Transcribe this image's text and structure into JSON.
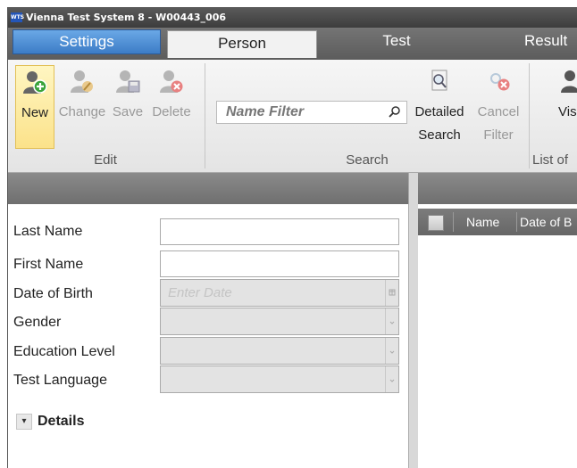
{
  "window": {
    "title": "Vienna Test System 8 - W00443_006",
    "logo_text": "WTS"
  },
  "tabs": [
    {
      "label": "Settings"
    },
    {
      "label": "Person"
    },
    {
      "label": "Test"
    },
    {
      "label": "Result"
    }
  ],
  "ribbon": {
    "edit": {
      "label": "Edit",
      "new": "New",
      "change": "Change",
      "save": "Save",
      "delete": "Delete"
    },
    "search": {
      "label": "Search",
      "name_filter_placeholder": "Name Filter",
      "detailed_search_line1": "Detailed",
      "detailed_search_line2": "Search",
      "cancel_filter_line1": "Cancel",
      "cancel_filter_line2": "Filter"
    },
    "list": {
      "label": "List of",
      "visible_label": "Vis"
    }
  },
  "form": {
    "last_name": "Last Name",
    "first_name": "First Name",
    "date_of_birth": "Date of Birth",
    "date_placeholder": "Enter Date",
    "gender": "Gender",
    "education_level": "Education Level",
    "test_language": "Test Language",
    "details": "Details"
  },
  "grid": {
    "columns": [
      "Name",
      "Date of B"
    ]
  },
  "colors": {
    "accent_blue": "#3c7cc6",
    "new_highlight": "#fbe28a",
    "add_green": "#3aa33a",
    "delete_red": "#d23a3a"
  }
}
